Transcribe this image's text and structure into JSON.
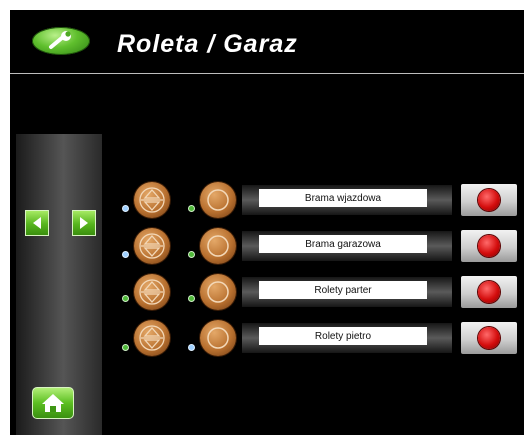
{
  "header": {
    "title": "Roleta / Garaz",
    "icon": "wrench-icon"
  },
  "sidebar": {
    "prev_icon": "arrow-left-icon",
    "next_icon": "arrow-right-icon",
    "home_icon": "home-icon"
  },
  "rows": [
    {
      "label": "Brama wjazdowa",
      "dot1": "blue",
      "dot2": "green"
    },
    {
      "label": "Brama garazowa",
      "dot1": "blue",
      "dot2": "green"
    },
    {
      "label": "Rolety parter",
      "dot1": "green",
      "dot2": "green"
    },
    {
      "label": "Rolety pietro",
      "dot1": "green",
      "dot2": "blue"
    }
  ],
  "colors": {
    "background": "#000000",
    "accent_green": "#5fbf2d",
    "orb_brown": "#b8702f",
    "stop_red": "#d40d0d"
  }
}
